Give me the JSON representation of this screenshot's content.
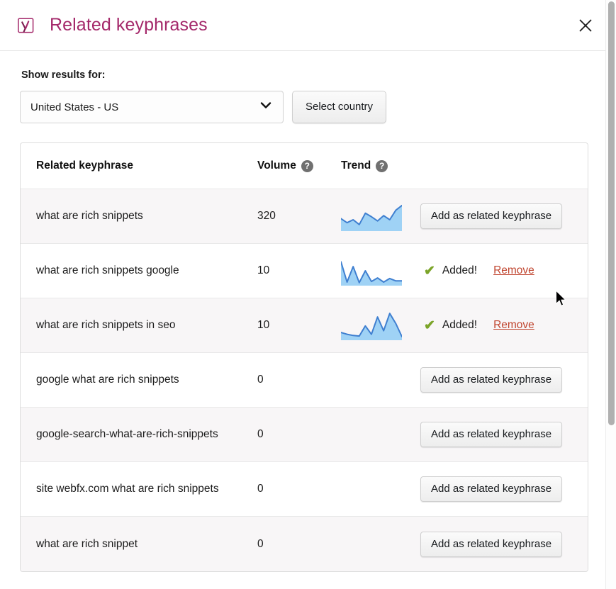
{
  "header": {
    "logo_icon": "yoast-logo-icon",
    "title": "Related keyphrases",
    "close_icon": "close-icon"
  },
  "controls": {
    "label": "Show results for:",
    "country_select": {
      "value": "United States - US",
      "chevron_icon": "chevron-down-icon"
    },
    "select_country_button": "Select country"
  },
  "table": {
    "columns": {
      "phrase": "Related keyphrase",
      "volume": "Volume",
      "trend": "Trend",
      "help_icon": "help-circle-icon"
    },
    "action_labels": {
      "add": "Add as related keyphrase",
      "added": "Added!",
      "remove": "Remove",
      "check_icon": "check-icon"
    },
    "rows": [
      {
        "phrase": "what are rich snippets",
        "volume": "320",
        "state": "add",
        "trend": "area",
        "trend_points": [
          58,
          72,
          62,
          78,
          40,
          52,
          66,
          48,
          62,
          30,
          14
        ],
        "has_trend": true
      },
      {
        "phrase": "what are rich snippets google",
        "volume": "10",
        "state": "added",
        "trend": "area",
        "trend_points": [
          20,
          88,
          36,
          90,
          50,
          86,
          74,
          88,
          76,
          84,
          84
        ],
        "has_trend": true
      },
      {
        "phrase": "what are rich snippets in seo",
        "volume": "10",
        "state": "added",
        "trend": "area",
        "trend_points": [
          74,
          80,
          84,
          86,
          52,
          80,
          22,
          68,
          10,
          44,
          88
        ],
        "has_trend": true
      },
      {
        "phrase": "google what are rich snippets",
        "volume": "0",
        "state": "add",
        "trend": "none",
        "trend_points": [],
        "has_trend": false
      },
      {
        "phrase": "google-search-what-are-rich-snippets",
        "volume": "0",
        "state": "add",
        "trend": "none",
        "trend_points": [],
        "has_trend": false
      },
      {
        "phrase": "site webfx.com what are rich snippets",
        "volume": "0",
        "state": "add",
        "trend": "none",
        "trend_points": [],
        "has_trend": false
      },
      {
        "phrase": "what are rich snippet",
        "volume": "0",
        "state": "add",
        "trend": "none",
        "trend_points": [],
        "has_trend": false
      }
    ]
  },
  "colors": {
    "brand_purple": "#a4286a",
    "trend_line": "#3f7fd0",
    "trend_fill": "#9fd2f5",
    "added_check": "#7ba428",
    "remove_link": "#c0452f",
    "row_shaded": "#f8f6f7"
  },
  "scrollbar": {
    "thumb_name": "vertical-scrollbar-thumb"
  }
}
